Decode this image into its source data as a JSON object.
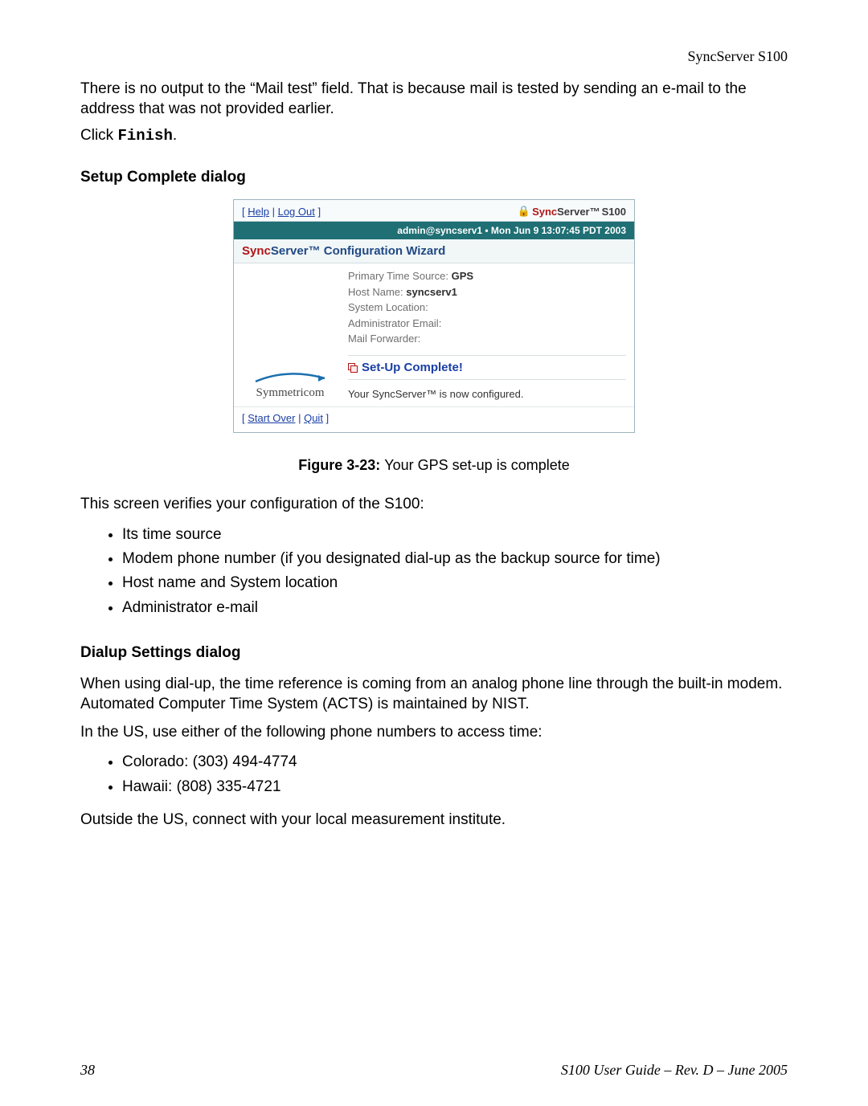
{
  "header": {
    "doc_title": "SyncServer S100"
  },
  "intro": {
    "paragraph": "There is no output to the “Mail test” field. That is because mail is tested by sending an e-mail to the address that was not provided earlier.",
    "click_prefix": "Click ",
    "click_word": "Finish",
    "click_suffix": "."
  },
  "section_setup": {
    "heading": "Setup Complete dialog"
  },
  "screenshot": {
    "top_links": {
      "open_bracket": "[ ",
      "help": "Help",
      "sep": " | ",
      "logout": "Log Out",
      "close_bracket": " ]"
    },
    "brand": {
      "lock": "🔒",
      "sync": "Sync",
      "server_tm": "Server™ ",
      "model": "S100"
    },
    "status_bar": "admin@syncserv1  •  Mon Jun 9 13:07:45 PDT 2003",
    "config_title": {
      "sync": "Sync",
      "rest": "Server™ Configuration Wizard"
    },
    "info": {
      "primary_label": "Primary Time Source: ",
      "primary_value": "GPS",
      "host_label": "Host Name: ",
      "host_value": "syncserv1",
      "sysloc": "System Location:",
      "admin_email": "Administrator Email:",
      "mail_fwd": "Mail Forwarder:"
    },
    "logo_text": "Symmetricom",
    "setup_complete": "Set-Up Complete!",
    "now_configured": "Your SyncServer™ is now configured.",
    "bottom_links": {
      "open_bracket": "[ ",
      "start_over": "Start Over",
      "sep": " | ",
      "quit": "Quit",
      "close_bracket": " ]"
    }
  },
  "figure_caption": {
    "label": "Figure 3-23:  ",
    "text": "Your GPS set-up is complete"
  },
  "verify": {
    "intro": "This screen verifies your configuration of the S100:",
    "items": [
      "Its time source",
      "Modem phone number (if you designated dial-up as the backup source for time)",
      "Host name and System location",
      "Administrator e-mail"
    ]
  },
  "section_dialup": {
    "heading": "Dialup Settings dialog",
    "paragraph": "When using dial-up, the time reference is coming from an analog phone line through the built-in modem. Automated Computer Time System (ACTS) is maintained by NIST.",
    "intro_numbers": "In the US, use either of the following phone numbers to access time:",
    "numbers": [
      "Colorado: (303) 494-4774",
      "Hawaii: (808) 335-4721"
    ],
    "outside": "Outside the US, connect with your local measurement institute."
  },
  "footer": {
    "page_no": "38",
    "doc_rev": "S100 User Guide – Rev. D – June 2005"
  }
}
